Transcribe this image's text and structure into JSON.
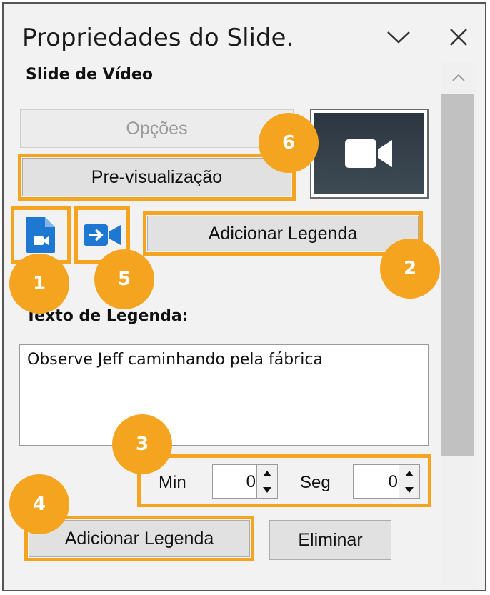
{
  "window": {
    "title": "Propriedades do Slide."
  },
  "section": {
    "title": "Slide de Vídeo"
  },
  "buttons": {
    "options": "Opções",
    "preview": "Pre-visualização",
    "add_caption_top": "Adicionar Legenda",
    "add_caption_bottom": "Adicionar Legenda",
    "delete": "Eliminar"
  },
  "caption": {
    "label": "Texto de Legenda:",
    "text": "Observe Jeff caminhando pela fábrica"
  },
  "time": {
    "min_label": "Min",
    "min_value": "0",
    "sec_label": "Seg",
    "sec_value": "0"
  },
  "badges": [
    "1",
    "2",
    "3",
    "4",
    "5",
    "6"
  ],
  "icons": {
    "titlebar_collapse": "chevron-down-icon",
    "titlebar_close": "close-icon",
    "scroll_up": "chevron-up-icon",
    "file": "file-video-icon",
    "camera": "video-camera-arrow-icon",
    "preview": "video-camera-icon"
  },
  "colors": {
    "highlight": "#f5a41f",
    "icon_blue": "#1e78d2",
    "panel_bg": "#f2f2f2"
  }
}
